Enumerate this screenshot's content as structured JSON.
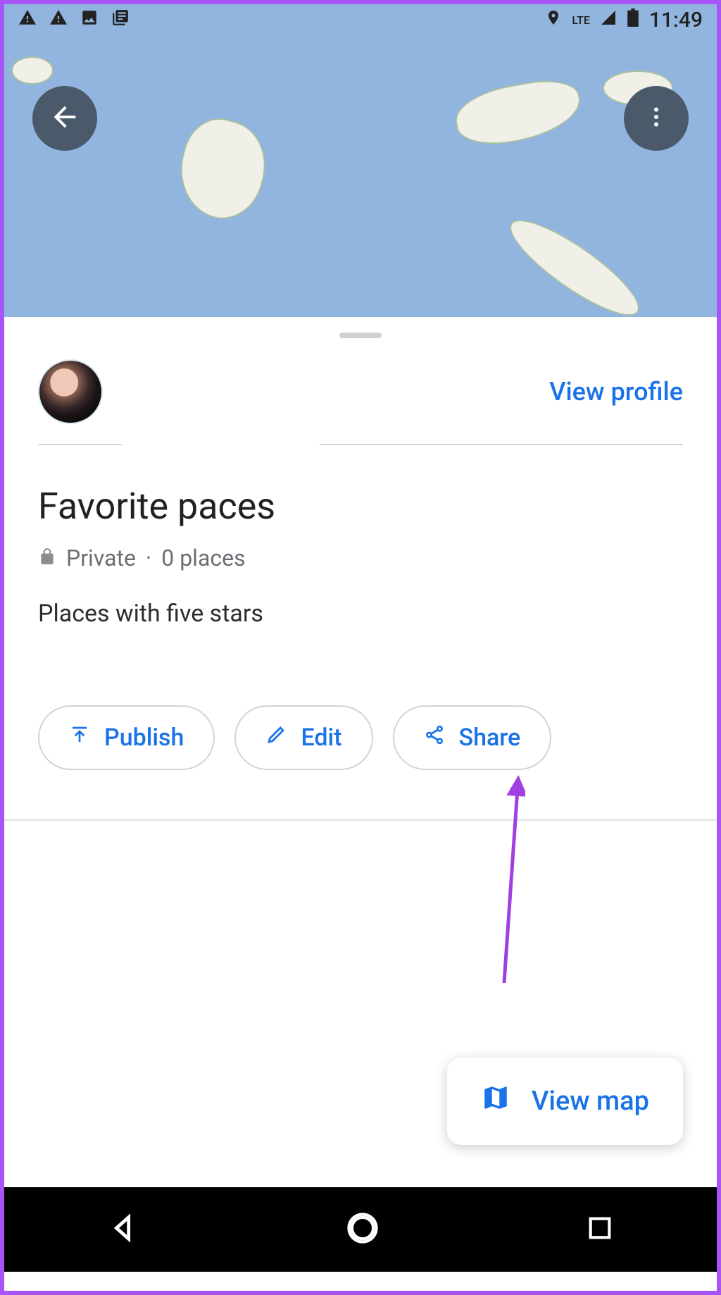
{
  "status_bar": {
    "network": "LTE",
    "time": "11:49"
  },
  "profile": {
    "view_profile_label": "View profile"
  },
  "list": {
    "title": "Favorite paces",
    "privacy": "Private",
    "places_count": "0 places",
    "separator": "·",
    "description": "Places with five stars"
  },
  "actions": {
    "publish": "Publish",
    "edit": "Edit",
    "share": "Share"
  },
  "fab": {
    "view_map": "View map"
  }
}
